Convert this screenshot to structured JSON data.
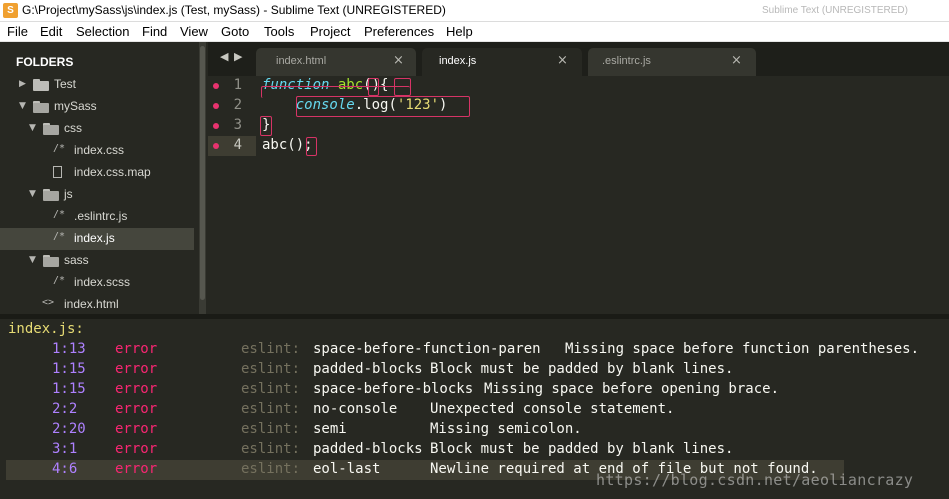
{
  "window": {
    "title": "G:\\Project\\mySass\\js\\index.js (Test, mySass) - Sublime Text (UNREGISTERED)",
    "ghost_title": "Sublime Text (UNREGISTERED)"
  },
  "menu": {
    "items": [
      "File",
      "Edit",
      "Selection",
      "Find",
      "View",
      "Goto",
      "Tools",
      "Project",
      "Preferences",
      "Help"
    ]
  },
  "sidebar": {
    "header": "FOLDERS",
    "items": [
      {
        "label": "Test",
        "type": "folder",
        "expanded": false
      },
      {
        "label": "mySass",
        "type": "folder",
        "expanded": true
      },
      {
        "label": "css",
        "type": "folder",
        "expanded": true
      },
      {
        "label": "index.css",
        "type": "file",
        "icon": "/*"
      },
      {
        "label": "index.css.map",
        "type": "file",
        "icon": ""
      },
      {
        "label": "js",
        "type": "folder",
        "expanded": true
      },
      {
        "label": ".eslintrc.js",
        "type": "file",
        "icon": "/*"
      },
      {
        "label": "index.js",
        "type": "file",
        "icon": "/*",
        "selected": true
      },
      {
        "label": "sass",
        "type": "folder",
        "expanded": true
      },
      {
        "label": "index.scss",
        "type": "file",
        "icon": "/*"
      },
      {
        "label": "index.html",
        "type": "file",
        "icon": "<>"
      }
    ]
  },
  "tabs": {
    "nav_back": "◀",
    "nav_forward": "▶",
    "close_glyph": "×",
    "items": [
      {
        "label": "index.html",
        "active": false
      },
      {
        "label": "index.js",
        "active": true
      },
      {
        "label": ".eslintrc.js",
        "active": false
      }
    ]
  },
  "editor": {
    "lines": [
      {
        "num": "1",
        "error": true
      },
      {
        "num": "2",
        "error": true
      },
      {
        "num": "3",
        "error": true
      },
      {
        "num": "4",
        "error": true,
        "current": true
      }
    ],
    "tokens": {
      "l1_keyword": "function",
      "l1_name": "abc",
      "l1_rest": "(){",
      "l2_indent": "    ",
      "l2_obj": "console",
      "l2_dot_method": ".log(",
      "l2_str": "'123'",
      "l2_close": ")",
      "l3_text": "}",
      "l4_text": "abc();"
    }
  },
  "output": {
    "title": "index.js:",
    "rows": [
      {
        "loc": "1:13",
        "severity": "error",
        "source": "eslint:",
        "rule": "space-before-function-paren",
        "message": "Missing space before function parentheses."
      },
      {
        "loc": "1:15",
        "severity": "error",
        "source": "eslint:",
        "rule": "padded-blocks",
        "message": "Block must be padded by blank lines."
      },
      {
        "loc": "1:15",
        "severity": "error",
        "source": "eslint:",
        "rule": "space-before-blocks",
        "message": "Missing space before opening brace."
      },
      {
        "loc": "2:2",
        "severity": "error",
        "source": "eslint:",
        "rule": "no-console",
        "message": "Unexpected console statement."
      },
      {
        "loc": "2:20",
        "severity": "error",
        "source": "eslint:",
        "rule": "semi",
        "message": "Missing semicolon."
      },
      {
        "loc": "3:1",
        "severity": "error",
        "source": "eslint:",
        "rule": "padded-blocks",
        "message": "Block must be padded by blank lines."
      },
      {
        "loc": "4:6",
        "severity": "error",
        "source": "eslint:",
        "rule": "eol-last",
        "message": "Newline required at end of file but not found.",
        "selected": true
      }
    ]
  },
  "watermark": "https://blog.csdn.net/aeoliancrazy",
  "colors": {
    "background": "#272822",
    "error_marker": "#e8336f",
    "keyword": "#66d9ef",
    "function_name": "#a6e22e",
    "string": "#e6db74",
    "location": "#ae81ff",
    "severity": "#f92672"
  }
}
